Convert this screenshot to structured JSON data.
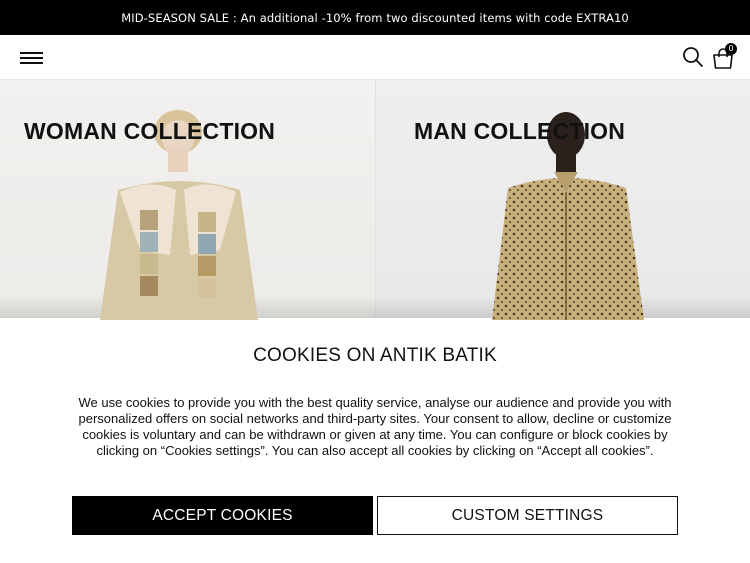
{
  "promo": {
    "text": "MID-SEASON SALE : An additional -10% from two discounted items with code EXTRA10"
  },
  "header": {
    "menu_icon": "hamburger-menu-icon",
    "search_icon": "search-icon",
    "cart_icon": "shopping-bag-icon",
    "cart_count": "0"
  },
  "collections": [
    {
      "title": "WOMAN COLLECTION"
    },
    {
      "title": "MAN COLLECTION"
    }
  ],
  "cookie_banner": {
    "title": "COOKIES ON ANTIK BATIK",
    "text": "We use cookies to provide you with the best quality service, analyse our audience and provide you with personalized offers on social networks and third-party sites. Your consent to allow, decline or customize cookies is voluntary and can be withdrawn or given at any time. You can configure or block cookies by clicking on “Cookies settings”. You can also accept all cookies by clicking on “Accept all cookies”.",
    "accept_label": "ACCEPT COOKIES",
    "custom_label": "CUSTOM SETTINGS"
  },
  "colors": {
    "promo_bg": "#000000",
    "accept_bg": "#000000",
    "text": "#111111"
  }
}
